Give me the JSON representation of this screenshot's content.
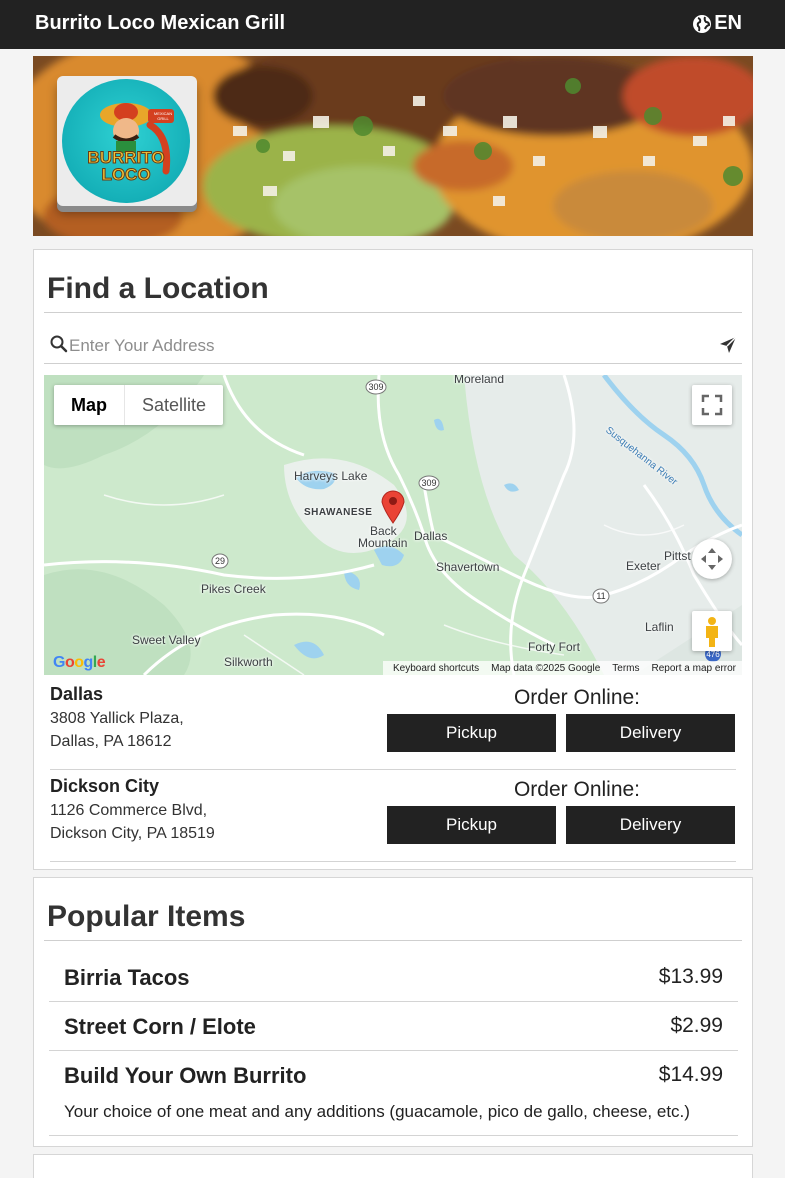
{
  "header": {
    "brand": "Burrito Loco Mexican Grill",
    "language": "EN"
  },
  "hero": {
    "logo_text_line1": "BURRITO",
    "logo_text_line2": "LOCO",
    "logo_badge": "MEXICAN GRILL"
  },
  "find_location": {
    "title": "Find a Location",
    "search_placeholder": "Enter Your Address",
    "search_value": ""
  },
  "map": {
    "type_map": "Map",
    "type_satellite": "Satellite",
    "labels": [
      "Moreland",
      "Harveys Lake",
      "SHAWANESE",
      "Back",
      "Mountain",
      "Dallas",
      "Shavertown",
      "Pikes Creek",
      "Exeter",
      "Pittst",
      "Sweet Valley",
      "Silkworth",
      "Forty Fort",
      "Laflin",
      "Susquehanna River"
    ],
    "route_shields": [
      "309",
      "309",
      "29",
      "11",
      "476"
    ],
    "google_logo": "Google",
    "attribution": [
      "Keyboard shortcuts",
      "Map data ©2025 Google",
      "Terms",
      "Report a map error"
    ]
  },
  "locations": [
    {
      "name": "Dallas",
      "address_line1": "3808 Yallick Plaza,",
      "address_line2": "Dallas, PA 18612",
      "order_label": "Order Online:",
      "pickup_label": "Pickup",
      "delivery_label": "Delivery"
    },
    {
      "name": "Dickson City",
      "address_line1": "1126 Commerce Blvd,",
      "address_line2": "Dickson City, PA 18519",
      "order_label": "Order Online:",
      "pickup_label": "Pickup",
      "delivery_label": "Delivery"
    }
  ],
  "popular": {
    "title": "Popular Items",
    "items": [
      {
        "name": "Birria Tacos",
        "price": "$13.99",
        "description": ""
      },
      {
        "name": "Street Corn / Elote",
        "price": "$2.99",
        "description": ""
      },
      {
        "name": "Build Your Own Burrito",
        "price": "$14.99",
        "description": "Your choice of one meat and any additions (guacamole, pico de gallo, cheese, etc.)"
      }
    ]
  },
  "colors": {
    "header_bg": "#222222",
    "button_bg": "#222222",
    "map_pin": "#ea4335"
  }
}
